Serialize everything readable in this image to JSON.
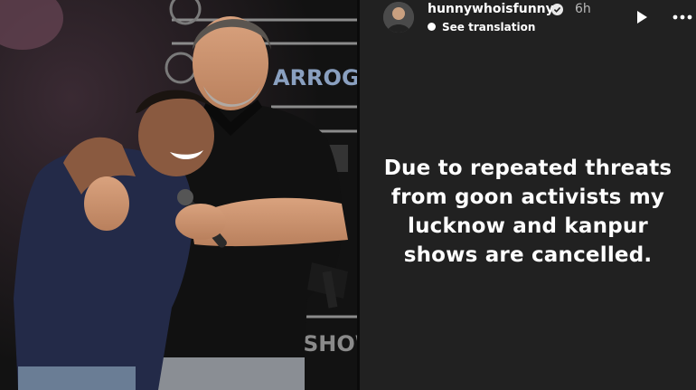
{
  "story": {
    "username": "hunnywhoisfunny",
    "timestamp": "6h",
    "see_translation": "See translation",
    "text_lines": [
      "Due to repeated threats",
      "from goon activists my",
      "lucknow and kanpur",
      "shows are cancelled."
    ]
  },
  "photo": {
    "backdrop_text": [
      "ARROGA",
      "SHOW"
    ]
  },
  "icons": {
    "verified": "verified-badge-icon",
    "play": "play-icon",
    "more": "more-options-icon",
    "translate": "globe-icon"
  },
  "colors": {
    "story_background": "#212121",
    "text": "#ffffff",
    "muted_text": "#b8b8b8",
    "verified_badge": "#0095f6"
  }
}
